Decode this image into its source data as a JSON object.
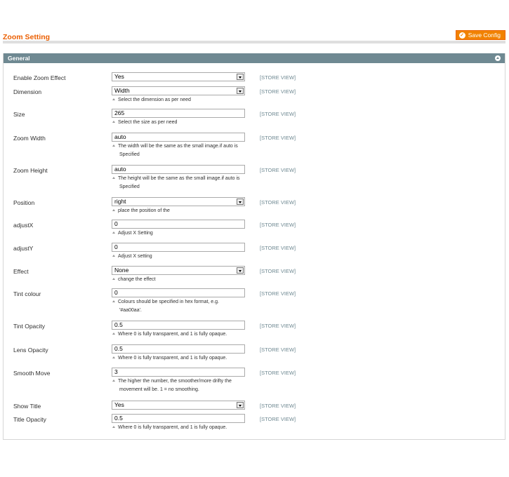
{
  "header": {
    "title": "Zoom Setting",
    "save_label": "Save Config"
  },
  "section": {
    "title": "General"
  },
  "store_view": "[STORE VIEW]",
  "fields": [
    {
      "label": "Enable Zoom Effect",
      "type": "select",
      "value": "Yes"
    },
    {
      "label": "Dimension",
      "type": "select",
      "value": "Width",
      "note": [
        "Select the dimension as per need"
      ]
    },
    {
      "label": "Size",
      "type": "text",
      "value": "265",
      "note": [
        "Select the size as per need"
      ]
    },
    {
      "label": "Zoom Width",
      "type": "text",
      "value": "auto",
      "note": [
        "The width will be the same as the small image.if auto is",
        "Specified"
      ]
    },
    {
      "label": "Zoom Height",
      "type": "text",
      "value": "auto",
      "note": [
        "The height will be the same as the small image.if auto is",
        "Specified"
      ]
    },
    {
      "label": "Position",
      "type": "select",
      "value": "right",
      "note": [
        "place the position of the"
      ]
    },
    {
      "label": "adjustX",
      "type": "text",
      "value": "0",
      "note": [
        "Adjust X Setting"
      ]
    },
    {
      "label": "adjustY",
      "type": "text",
      "value": "0",
      "note": [
        "Adjust X setting"
      ]
    },
    {
      "label": "Effect",
      "type": "select",
      "value": "None",
      "note": [
        "change the effect"
      ]
    },
    {
      "label": "Tint colour",
      "type": "text",
      "value": "0",
      "note": [
        "Colours should be specified in hex format, e.g.",
        "'#aa00aa'."
      ]
    },
    {
      "label": "Tint Opacity",
      "type": "text",
      "value": "0.5",
      "note": [
        "Where 0 is fully transparent, and 1 is fully opaque."
      ]
    },
    {
      "label": "Lens Opacity",
      "type": "text",
      "value": "0.5",
      "note": [
        "Where 0 is fully transparent, and 1 is fully opaque."
      ]
    },
    {
      "label": "Smooth Move",
      "type": "text",
      "value": "3",
      "note": [
        "The higher the number, the smoother/more drifty the",
        "movement will be. 1 = no smoothing."
      ]
    },
    {
      "label": "Show Title",
      "type": "select",
      "value": "Yes"
    },
    {
      "label": "Title Opacity",
      "type": "text",
      "value": "0.5",
      "note": [
        "Where 0 is fully transparent, and 1 is fully opaque."
      ]
    }
  ]
}
